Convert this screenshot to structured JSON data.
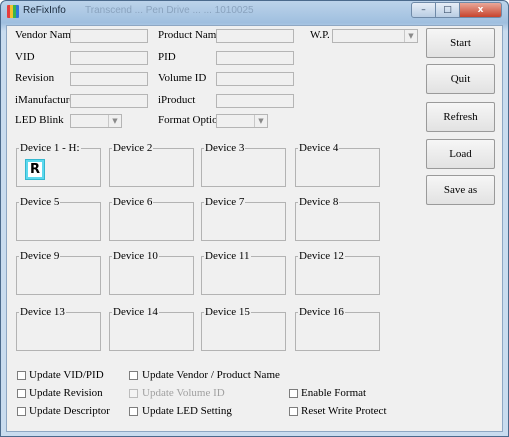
{
  "window": {
    "title": "ReFixInfo",
    "faded_title": "Transcend   ...   Pen Drive   ...   ...   1010025"
  },
  "fields": {
    "vendor_name": "Vendor Name",
    "product_name": "Product Name",
    "wp": "W.P.",
    "vid": "VID",
    "pid": "PID",
    "revision": "Revision",
    "volume_id": "Volume ID",
    "imanufacture": "iManufacture",
    "iproduct": "iProduct",
    "led_blink": "LED Blink",
    "format_option": "Format Option"
  },
  "buttons": {
    "start": "Start",
    "quit": "Quit",
    "refresh": "Refresh",
    "load": "Load",
    "save_as": "Save as"
  },
  "devices": [
    "Device 1 - H:",
    "Device 2",
    "Device 3",
    "Device 4",
    "Device 5",
    "Device 6",
    "Device 7",
    "Device 8",
    "Device 9",
    "Device 10",
    "Device 11",
    "Device 12",
    "Device 13",
    "Device 14",
    "Device 15",
    "Device 16"
  ],
  "device1_drive_letter": "R",
  "options": {
    "update_vid_pid": "Update VID/PID",
    "update_vendor_product": "Update Vendor / Product Name",
    "update_revision": "Update Revision",
    "update_volume_id": "Update Volume ID",
    "enable_format": "Enable Format",
    "update_descriptor": "Update Descriptor",
    "update_led_setting": "Update LED Setting",
    "reset_write_protect": "Reset Write Protect"
  },
  "caption": {
    "minimize": "–",
    "maximize": "□",
    "close": "x",
    "dropdown_arrow": "▼"
  },
  "colors": {
    "drive_accent": "#5dd9ee",
    "close_button": "#c7432c"
  }
}
